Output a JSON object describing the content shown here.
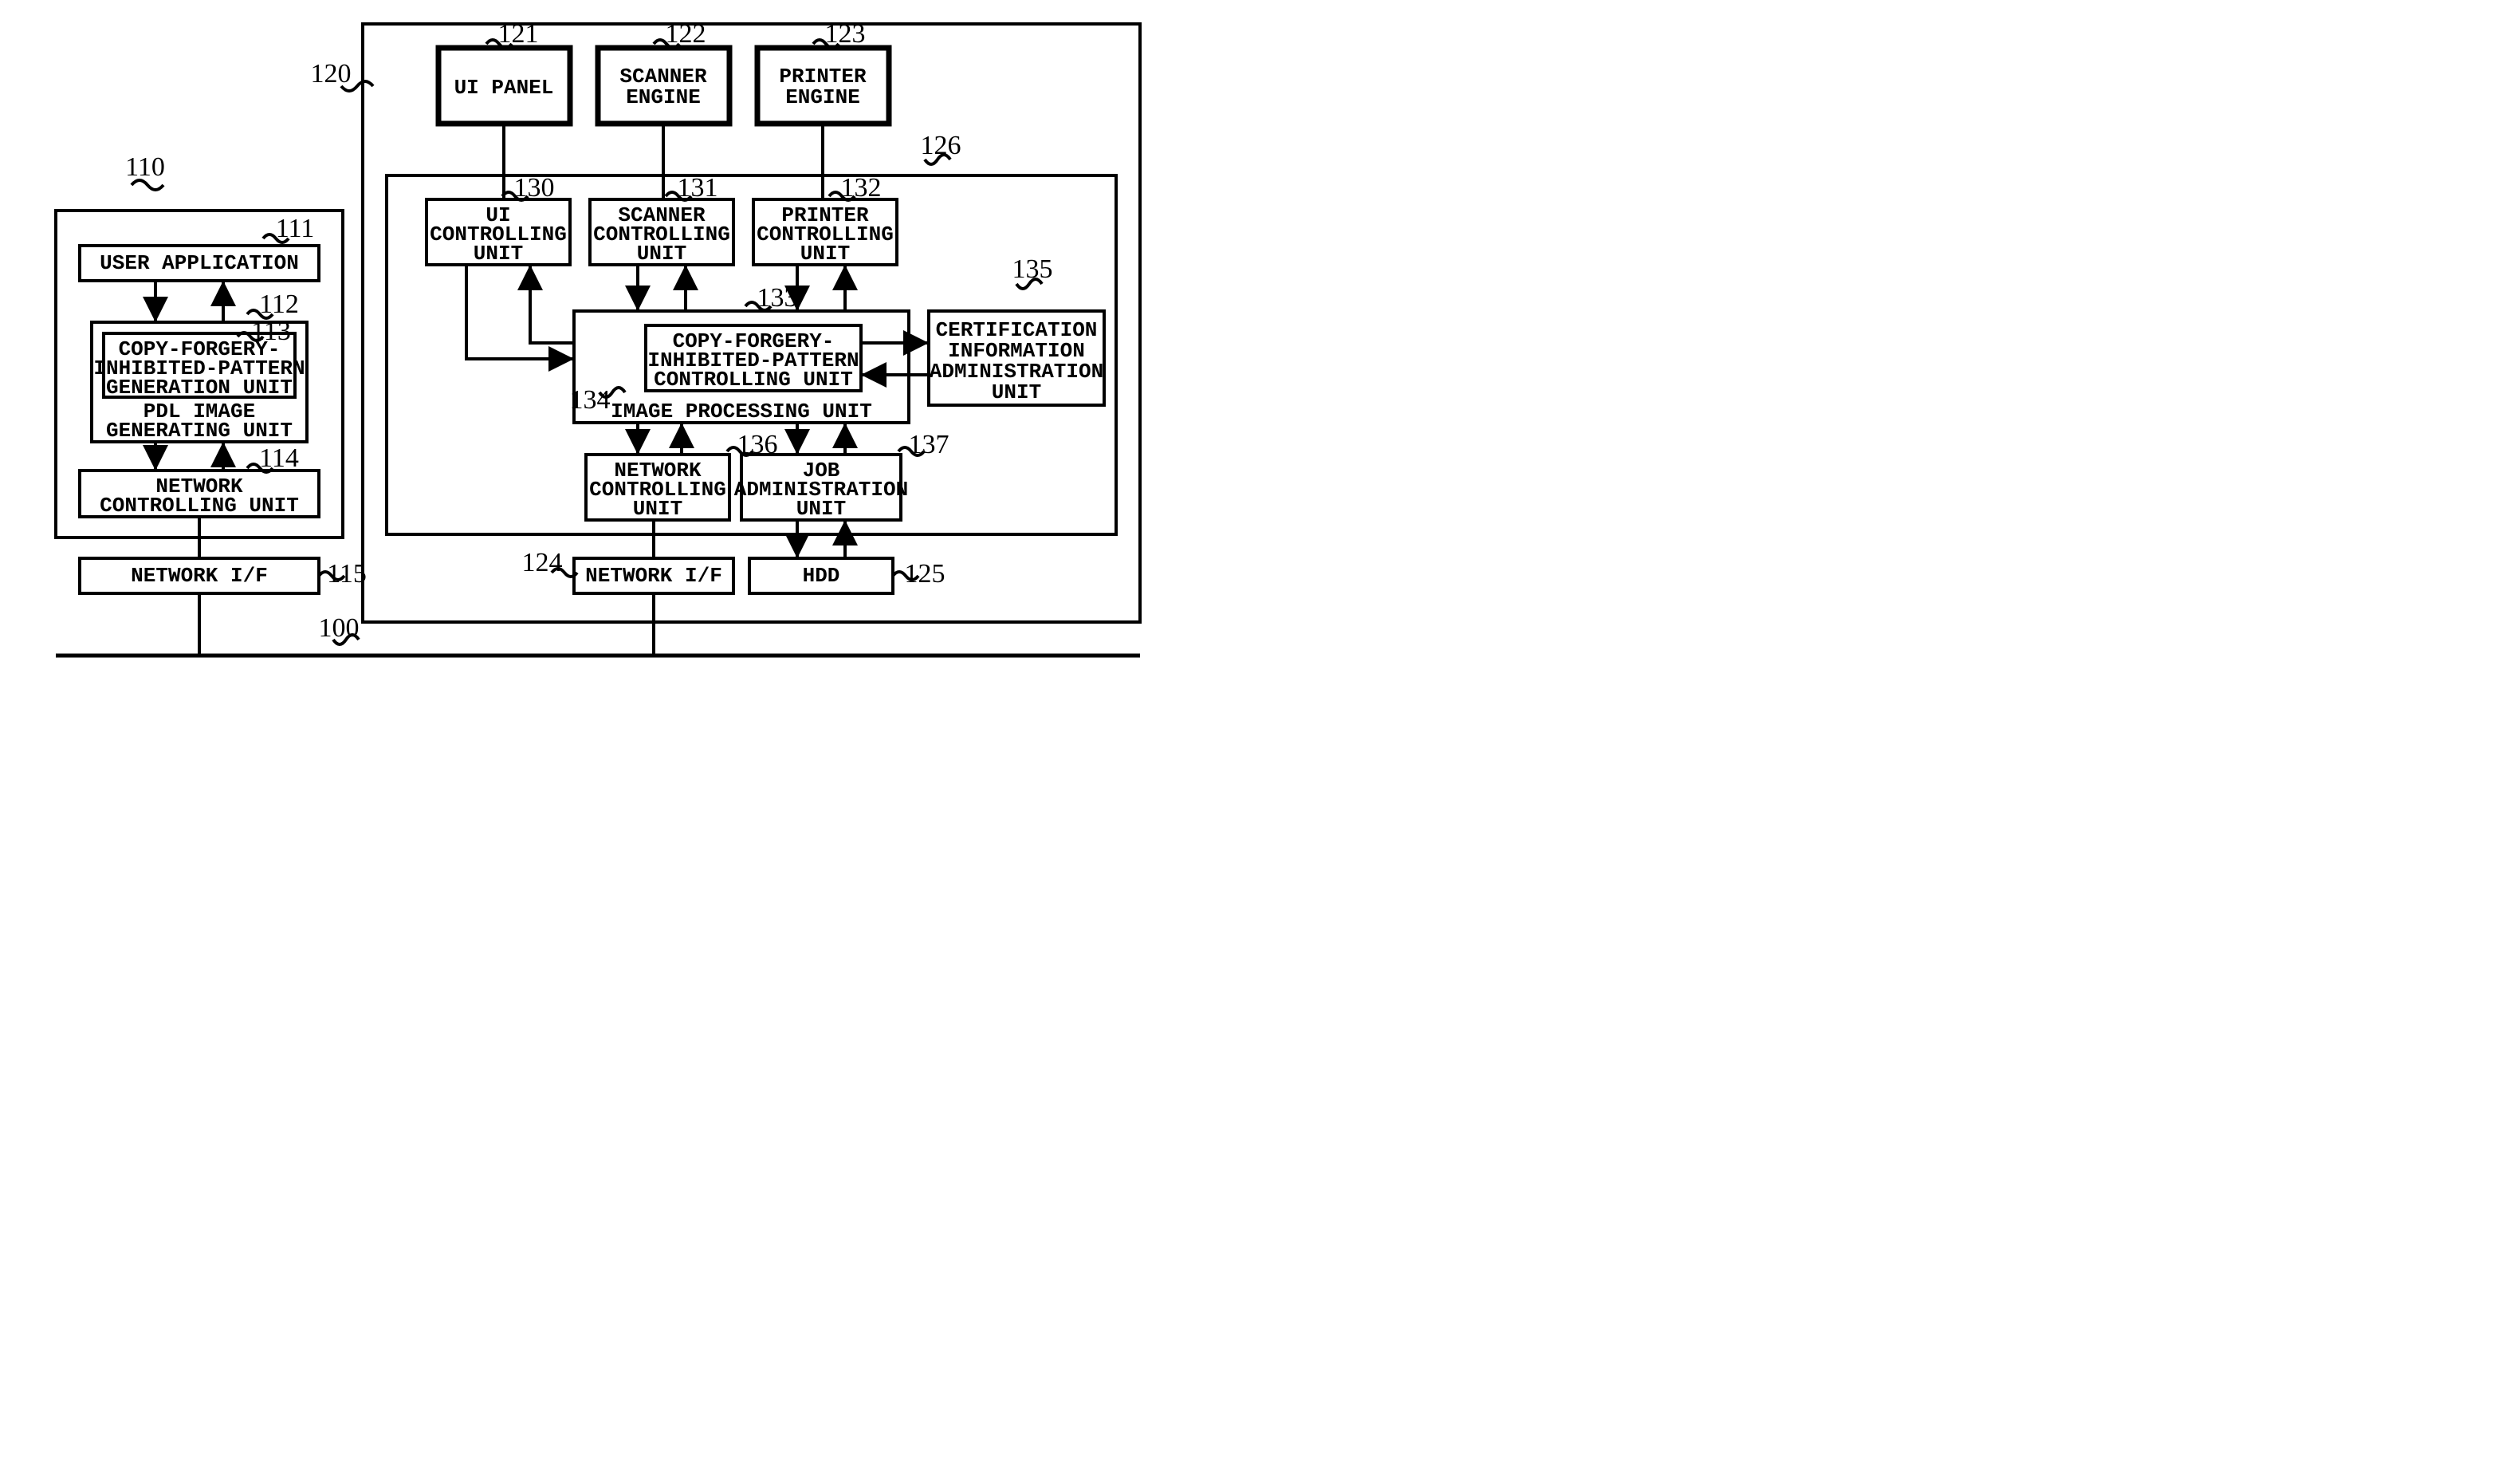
{
  "refs": {
    "r100": "100",
    "r110": "110",
    "r111": "111",
    "r112": "112",
    "r113": "113",
    "r114": "114",
    "r115": "115",
    "r120": "120",
    "r121": "121",
    "r122": "122",
    "r123": "123",
    "r124": "124",
    "r125": "125",
    "r126": "126",
    "r130": "130",
    "r131": "131",
    "r132": "132",
    "r133": "133",
    "r134": "134",
    "r135": "135",
    "r136": "136",
    "r137": "137"
  },
  "labels": {
    "user_application": "USER APPLICATION",
    "copy_forgery_l1": "COPY-FORGERY-",
    "copy_forgery_l2": "INHIBITED-PATTERN",
    "copy_forgery_l3": "GENERATION UNIT",
    "pdl_l1": "PDL IMAGE",
    "pdl_l2": "GENERATING UNIT",
    "net_ctrl_l1": "NETWORK",
    "net_ctrl_l2": "CONTROLLING UNIT",
    "net_if": "NETWORK I/F",
    "ui_panel": "UI PANEL",
    "scanner_l1": "SCANNER",
    "scanner_l2": "ENGINE",
    "printer_l1": "PRINTER",
    "printer_l2": "ENGINE",
    "ui_cu_l1": "UI",
    "ui_cu_l2": "CONTROLLING",
    "ui_cu_l3": "UNIT",
    "sc_cu_l1": "SCANNER",
    "sc_cu_l2": "CONTROLLING",
    "sc_cu_l3": "UNIT",
    "pr_cu_l1": "PRINTER",
    "pr_cu_l2": "CONTROLLING",
    "pr_cu_l3": "UNIT",
    "cfipcu_l1": "COPY-FORGERY-",
    "cfipcu_l2": "INHIBITED-PATTERN",
    "cfipcu_l3": "CONTROLLING UNIT",
    "ipu": "IMAGE PROCESSING UNIT",
    "ciau_l1": "CERTIFICATION",
    "ciau_l2": "INFORMATION",
    "ciau_l3": "ADMINISTRATION",
    "ciau_l4": "UNIT",
    "ncu2_l1": "NETWORK",
    "ncu2_l2": "CONTROLLING",
    "ncu2_l3": "UNIT",
    "jau_l1": "JOB",
    "jau_l2": "ADMINISTRATION",
    "jau_l3": "UNIT",
    "net_if2": "NETWORK I/F",
    "hdd": "HDD"
  }
}
